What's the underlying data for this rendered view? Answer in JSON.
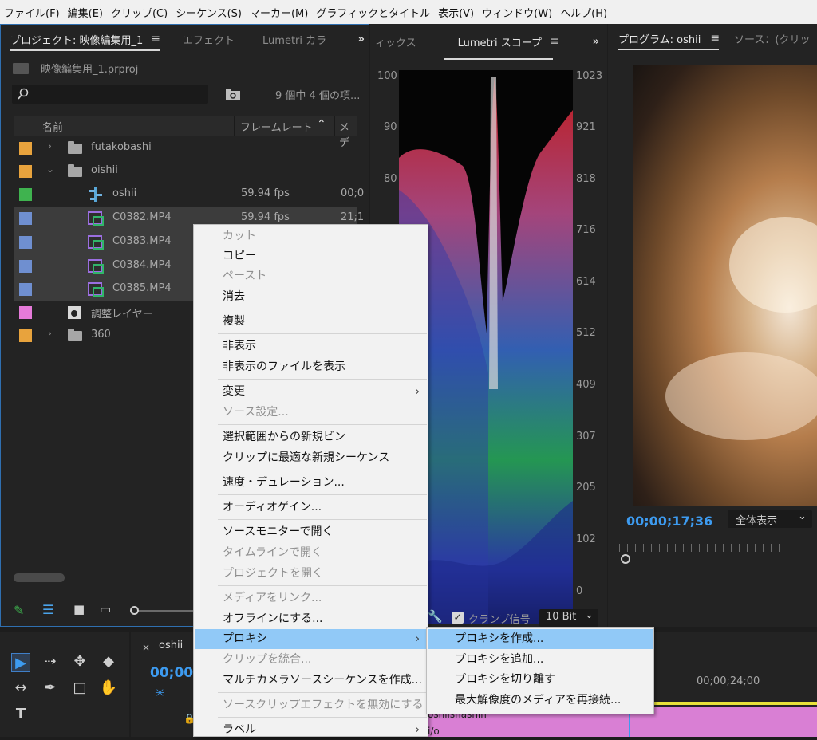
{
  "menubar": [
    "ファイル(F)",
    "編集(E)",
    "クリップ(C)",
    "シーケンス(S)",
    "マーカー(M)",
    "グラフィックとタイトル",
    "表示(V)",
    "ウィンドウ(W)",
    "ヘルプ(H)"
  ],
  "project": {
    "tabs": {
      "project": "プロジェクト: 映像編集用_1",
      "effects": "エフェクト",
      "lumetri": "Lumetri カラ",
      "more": "»"
    },
    "filename": "映像編集用_1.prproj",
    "item_count": "9 個中 4 個の項...",
    "columns": {
      "name": "名前",
      "framerate": "フレームレート",
      "media": "メデ"
    },
    "rows": [
      {
        "name": "futakobashi",
        "color": "#e8a33d",
        "fps": "",
        "media": "",
        "kind": "folder",
        "expanded": false
      },
      {
        "name": "oishii",
        "color": "#e8a33d",
        "fps": "",
        "media": "",
        "kind": "folder",
        "expanded": true
      },
      {
        "name": "oshii",
        "color": "#3fb34f",
        "fps": "59.94 fps",
        "media": "00;0",
        "kind": "sequence"
      },
      {
        "name": "C0382.MP4",
        "color": "#6f8fd0",
        "fps": "59.94 fps",
        "media": "21;1",
        "kind": "clip"
      },
      {
        "name": "C0383.MP4",
        "color": "#6f8fd0",
        "fps": "",
        "media": "",
        "kind": "clip"
      },
      {
        "name": "C0384.MP4",
        "color": "#6f8fd0",
        "fps": "",
        "media": "",
        "kind": "clip"
      },
      {
        "name": "C0385.MP4",
        "color": "#6f8fd0",
        "fps": "",
        "media": "",
        "kind": "clip"
      },
      {
        "name": "調整レイヤー",
        "color": "#e67ad9",
        "fps": "",
        "media": "",
        "kind": "adjust"
      },
      {
        "name": "360",
        "color": "#e8a33d",
        "fps": "",
        "media": "",
        "kind": "folder",
        "expanded": false
      }
    ]
  },
  "scopes": {
    "tab_left": "ィックス",
    "tab_active": "Lumetri スコープ",
    "more": "»",
    "left_scale": [
      "100",
      "90",
      "80"
    ],
    "right_scale": [
      "1023",
      "921",
      "818",
      "716",
      "614",
      "512",
      "409",
      "307",
      "205",
      "102",
      "0"
    ],
    "clamp_label": "クランプ信号",
    "bit_depth": "10 Bit"
  },
  "program": {
    "tab": "プログラム: oshii",
    "source_tab": "ソース：(クリッ",
    "timecode": "00;00;17;36",
    "zoom": "全体表示"
  },
  "timeline": {
    "sequence_tab": "oshii",
    "timecode": "00;00;",
    "ruler_time": "00;00;24;00",
    "clip_label": "oshiishashin",
    "clip_label2": "i/o"
  },
  "context_menu": [
    {
      "label": "カット",
      "disabled": true
    },
    {
      "label": "コピー",
      "disabled": false
    },
    {
      "label": "ペースト",
      "disabled": true
    },
    {
      "label": "消去",
      "disabled": false
    },
    {
      "label": "複製",
      "disabled": false
    },
    {
      "label": "非表示",
      "disabled": false
    },
    {
      "label": "非表示のファイルを表示",
      "disabled": false
    },
    {
      "label": "変更",
      "disabled": false,
      "submenu": true
    },
    {
      "label": "ソース設定...",
      "disabled": true
    },
    {
      "label": "選択範囲からの新規ビン",
      "disabled": false
    },
    {
      "label": "クリップに最適な新規シーケンス",
      "disabled": false
    },
    {
      "label": "速度・デュレーション...",
      "disabled": false
    },
    {
      "label": "オーディオゲイン...",
      "disabled": false
    },
    {
      "label": "ソースモニターで開く",
      "disabled": false
    },
    {
      "label": "タイムラインで開く",
      "disabled": true
    },
    {
      "label": "プロジェクトを開く",
      "disabled": true
    },
    {
      "label": "メディアをリンク...",
      "disabled": true
    },
    {
      "label": "オフラインにする...",
      "disabled": false
    },
    {
      "label": "プロキシ",
      "disabled": false,
      "submenu": true,
      "highlighted": true
    },
    {
      "label": "クリップを統合...",
      "disabled": true
    },
    {
      "label": "マルチカメラソースシーケンスを作成...",
      "disabled": false
    },
    {
      "label": "ソースクリップエフェクトを無効にする",
      "disabled": true
    },
    {
      "label": "ラベル",
      "disabled": false,
      "submenu": true
    }
  ],
  "submenu": [
    {
      "label": "プロキシを作成...",
      "highlighted": true
    },
    {
      "label": "プロキシを追加..."
    },
    {
      "label": "プロキシを切り離す"
    },
    {
      "label": "最大解像度のメディアを再接続..."
    }
  ],
  "colors": {
    "accent_blue": "#2f8ddd",
    "menu_highlight": "#91c9f7",
    "timeline_clip": "#d97fd4"
  }
}
